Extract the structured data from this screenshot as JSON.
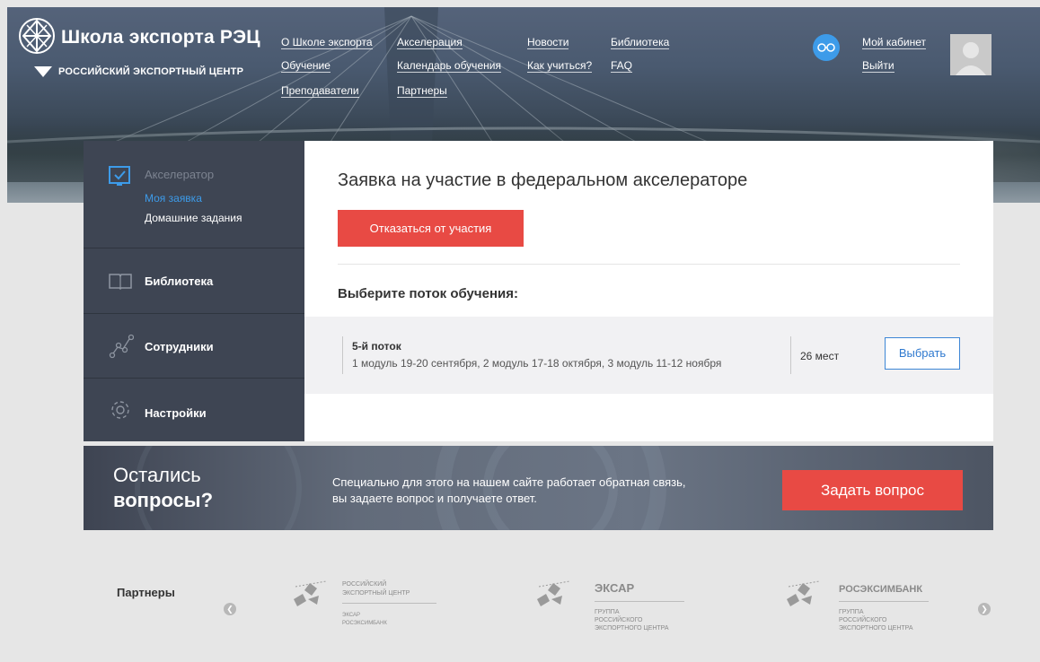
{
  "header": {
    "logo_title": "Школа экспорта РЭЦ",
    "logo_subtitle": "РОССИЙСКИЙ ЭКСПОРТНЫЙ ЦЕНТР",
    "nav": [
      {
        "label": "О Школе экспорта"
      },
      {
        "label": "Обучение"
      },
      {
        "label": "Преподаватели"
      },
      {
        "label": "Акселерация"
      },
      {
        "label": "Календарь обучения"
      },
      {
        "label": "Партнеры"
      },
      {
        "label": "Новости"
      },
      {
        "label": "Как учиться?"
      },
      {
        "label": "Библиотека"
      },
      {
        "label": "FAQ"
      }
    ],
    "cabinet_label": "Мой кабинет",
    "logout_label": "Выйти"
  },
  "sidebar": {
    "accelerator": {
      "label": "Акселератор",
      "items": [
        {
          "label": "Моя заявка",
          "active": true
        },
        {
          "label": "Домашние задания",
          "active": false
        }
      ]
    },
    "library": "Библиотека",
    "employees": "Сотрудники",
    "settings": "Настройки"
  },
  "main": {
    "title": "Заявка на участие в федеральном акселераторе",
    "decline_button": "Отказаться от участия",
    "choose_stream_label": "Выберите поток обучения:",
    "stream": {
      "name": "5-й поток",
      "dates": "1 модуль 19-20 сентября, 2 модуль 17-18 октября, 3 модуль 11-12 ноября",
      "seats": "26 мест",
      "select_button": "Выбрать"
    }
  },
  "banner": {
    "question_line1": "Остались",
    "question_line2": "вопросы?",
    "text_line1": "Специально для этого на нашем сайте работает обратная связь,",
    "text_line2": "вы задаете вопрос и получаете ответ.",
    "ask_button": "Задать вопрос"
  },
  "partners": {
    "label": "Партнеры",
    "p1": {
      "line1": "РОССИЙСКИЙ",
      "line2": "ЭКСПОРТНЫЙ ЦЕНТР",
      "sub1": "ЭКСАР",
      "sub2": "РОСЭКСИМБАНК"
    },
    "p2": {
      "name": "ЭКСАР",
      "line1": "ГРУППА",
      "line2": "РОССИЙСКОГО",
      "line3": "ЭКСПОРТНОГО ЦЕНТРА"
    },
    "p3": {
      "name": "РОСЭКСИМБАНК",
      "line1": "ГРУППА",
      "line2": "РОССИЙСКОГО",
      "line3": "ЭКСПОРТНОГО ЦЕНТРА"
    }
  },
  "colors": {
    "accent_red": "#e84a44",
    "link_blue": "#2f79cf",
    "sidebar_bg": "#3e4553",
    "active_item": "#3d9be9"
  },
  "icons": [
    "globe-logo-icon",
    "glasses-icon",
    "user-avatar",
    "checkbox-icon",
    "book-icon",
    "chart-line-icon",
    "gear-icon",
    "chevron-left-icon",
    "chevron-right-icon"
  ]
}
